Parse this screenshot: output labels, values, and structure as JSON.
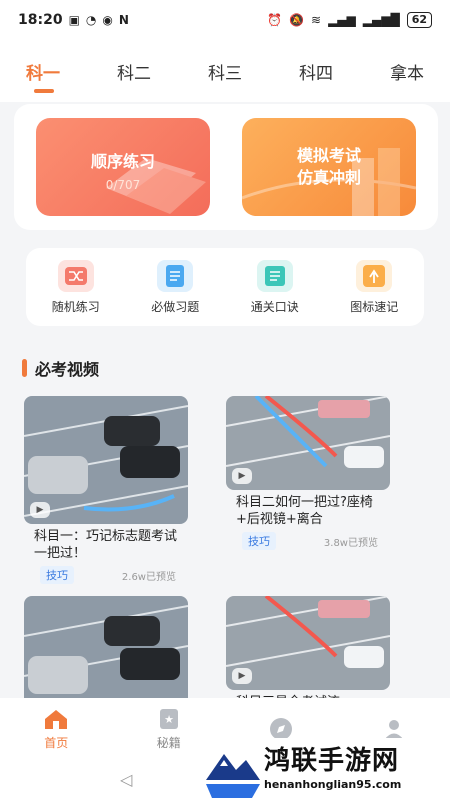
{
  "status_bar": {
    "time": "18:20",
    "battery": "62"
  },
  "tabs": [
    {
      "label": "科一",
      "active": true
    },
    {
      "label": "科二",
      "active": false
    },
    {
      "label": "科三",
      "active": false
    },
    {
      "label": "科四",
      "active": false
    },
    {
      "label": "拿本",
      "active": false
    }
  ],
  "hero": {
    "sequential": {
      "title": "顺序练习",
      "progress": "0/707"
    },
    "mock": {
      "title_line1": "模拟考试",
      "title_line2": "仿真冲刺"
    }
  },
  "quick_actions": [
    {
      "label": "随机练习",
      "icon": "shuffle-icon",
      "color": "#f47a6b"
    },
    {
      "label": "必做习题",
      "icon": "document-icon",
      "color": "#4aa8f0"
    },
    {
      "label": "通关口诀",
      "icon": "notes-icon",
      "color": "#3cc6b8"
    },
    {
      "label": "图标速记",
      "icon": "sign-arrow-icon",
      "color": "#fbae4a"
    }
  ],
  "section": {
    "title": "必考视频"
  },
  "videos": [
    {
      "title": "科目一：巧记标志题考试一把过！",
      "tag": "技巧",
      "views": "2.6w已预览"
    },
    {
      "title": "科目二如何一把过?座椅+后视镜+离合",
      "tag": "技巧",
      "views": "3.8w已预览"
    },
    {
      "title": "",
      "tag": "",
      "views": ""
    },
    {
      "title": "科目三最全考试流",
      "tag": "",
      "views": ""
    }
  ],
  "bottom_nav": [
    {
      "label": "首页",
      "active": true
    },
    {
      "label": "秘籍",
      "active": false
    },
    {
      "label": "",
      "active": false
    },
    {
      "label": "",
      "active": false
    }
  ],
  "watermark": {
    "text": "鸿联手游网",
    "url": "henanhonglian95.com"
  },
  "colors": {
    "accent": "#f07a3c",
    "tag_bg": "#e7f1fd",
    "tag_fg": "#3a7ae0"
  }
}
